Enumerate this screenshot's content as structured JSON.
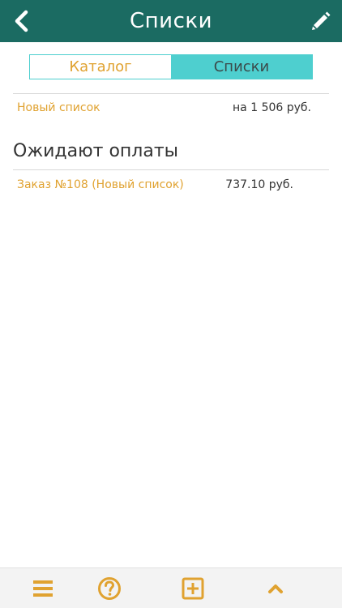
{
  "header": {
    "title": "Списки",
    "back_icon": "chevron-left-icon",
    "edit_icon": "pencil-icon",
    "background": "#1b6b62"
  },
  "segmented": {
    "tabs": [
      {
        "label": "Каталог",
        "selected": false
      },
      {
        "label": "Списки",
        "selected": true
      }
    ],
    "accent": "#4ecfcf"
  },
  "lists": [
    {
      "name": "Новый список",
      "amount": "на 1 506 руб."
    }
  ],
  "awaiting_payment": {
    "title": "Ожидают оплаты",
    "orders": [
      {
        "name": "Заказ №108 (Новый список)",
        "amount": "737.10 руб."
      }
    ]
  },
  "bottom_bar": {
    "icons": [
      "menu-icon",
      "help-icon",
      "add-icon",
      "chevron-up-icon"
    ],
    "accent": "#e0a230"
  }
}
